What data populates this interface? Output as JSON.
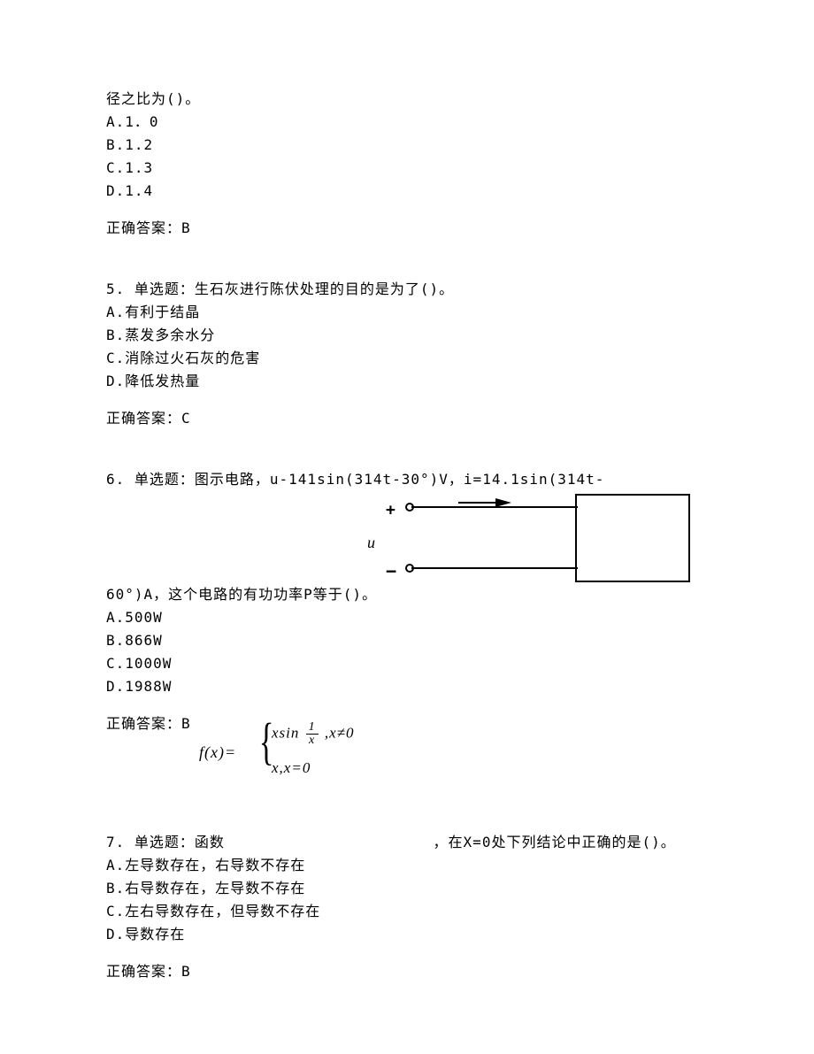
{
  "q4_tail": {
    "stem_cont": "径之比为()。",
    "options": {
      "A": "A.1．0",
      "B": "B.1.2",
      "C": "C.1.3",
      "D": "D.1.4"
    },
    "answer": "正确答案：B"
  },
  "q5": {
    "stem": "5. 单选题：生石灰进行陈伏处理的目的是为了()。",
    "options": {
      "A": "A.有利于结晶",
      "B": "B.蒸发多余水分",
      "C": "C.消除过火石灰的危害",
      "D": "D.降低发热量"
    },
    "answer": "正确答案：C"
  },
  "q6": {
    "stem1": "6. 单选题：图示电路，u-141sin(314t-30°)V，i=14.1sin(314t-",
    "stem2": "60°)A，这个电路的有功功率P等于()。",
    "diagram": {
      "plus": "+",
      "minus": "−",
      "u": "u"
    },
    "options": {
      "A": "A.500W",
      "B": "B.866W",
      "C": "C.1000W",
      "D": "D.1988W"
    },
    "answer": "正确答案：B"
  },
  "q7": {
    "stem_before": "7. 单选题：函数",
    "stem_after": "，在X=0处下列结论中正确的是()。",
    "formula": {
      "fx": "f(x)=",
      "top_pre": "xsin",
      "top_num": "1",
      "top_den": "x",
      "top_post": ",x≠0",
      "bot": "x,x=0"
    },
    "options": {
      "A": "A.左导数存在，右导数不存在",
      "B": "B.右导数存在，左导数不存在",
      "C": "C.左右导数存在，但导数不存在",
      "D": "D.导数存在"
    },
    "answer": "正确答案：B"
  }
}
